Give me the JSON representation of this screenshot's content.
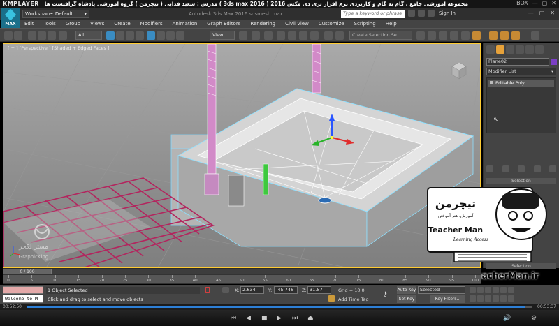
{
  "player": {
    "logo": "KMPLAYER",
    "title": "مجموعه آموزشی جامع ، گام به گام و کاربردی نرم افزار تری دی مکس 2016 ( 3ds max 2016 ) مدرس : سعید فدایی ( تیچرمن ) گروه آموزشی پادشاه گرافیست ها",
    "window_controls": [
      "BOX",
      "—",
      "▢",
      "✕"
    ],
    "time_elapsed": "00:52:50",
    "time_total": "00:53:37",
    "progress_fraction": 0.985
  },
  "app": {
    "logo_label": "MAX",
    "workspace": "Workspace: Default",
    "document_title": "Autodesk 3ds Max 2016     sdsmesh.max",
    "search_placeholder": "Type a keyword or phrase",
    "sign_in": "Sign In",
    "window_controls": [
      "—",
      "▢",
      "✕"
    ]
  },
  "menu": [
    "Edit",
    "Tools",
    "Group",
    "Views",
    "Create",
    "Modifiers",
    "Animation",
    "Graph Editors",
    "Rendering",
    "Civil View",
    "Customize",
    "Scripting",
    "Help"
  ],
  "toolbar": {
    "filter": "All",
    "ref_coord": "View",
    "selection_set": "Create Selection Se"
  },
  "viewport": {
    "label": "[ + ] [Perspective ] [Shaded + Edged Faces ]"
  },
  "command_panel": {
    "object_name": "Plane02",
    "modifier_list": "Modifier List",
    "stack_item": "Editable Poly",
    "rollout": "Selection",
    "rollout_bottom": "Selection"
  },
  "timeline": {
    "slider": "0 / 100",
    "ticks": [
      "0",
      "5",
      "10",
      "15",
      "20",
      "25",
      "30",
      "35",
      "40",
      "45",
      "50",
      "55",
      "60",
      "65",
      "70",
      "75",
      "80",
      "85",
      "90",
      "95",
      "100"
    ]
  },
  "status": {
    "listener": "Welcome to M",
    "selected": "1 Object Selected",
    "prompt": "Click and drag to select and move objects",
    "x_label": "X:",
    "x_value": "2.634",
    "y_label": "Y:",
    "y_value": "-45.746",
    "z_label": "Z:",
    "z_value": "31.57",
    "grid": "Grid = 10.0",
    "add_time_tag": "Add Time Tag",
    "auto_key": "Auto Key",
    "set_key": "Set Key",
    "selected_dd": "Selected",
    "key_filters": "Key Filters..."
  },
  "watermark": {
    "brand_fa": "تیچرمن",
    "tagline_fa": "آموزش، هنر آموختن",
    "brand_en": "Teacher Man",
    "slogan": "Learning Access",
    "url": "www.TeacherMan.ir",
    "small_logo_fa": "مستر لکچر",
    "small_logo_en": "GraphicKing"
  }
}
